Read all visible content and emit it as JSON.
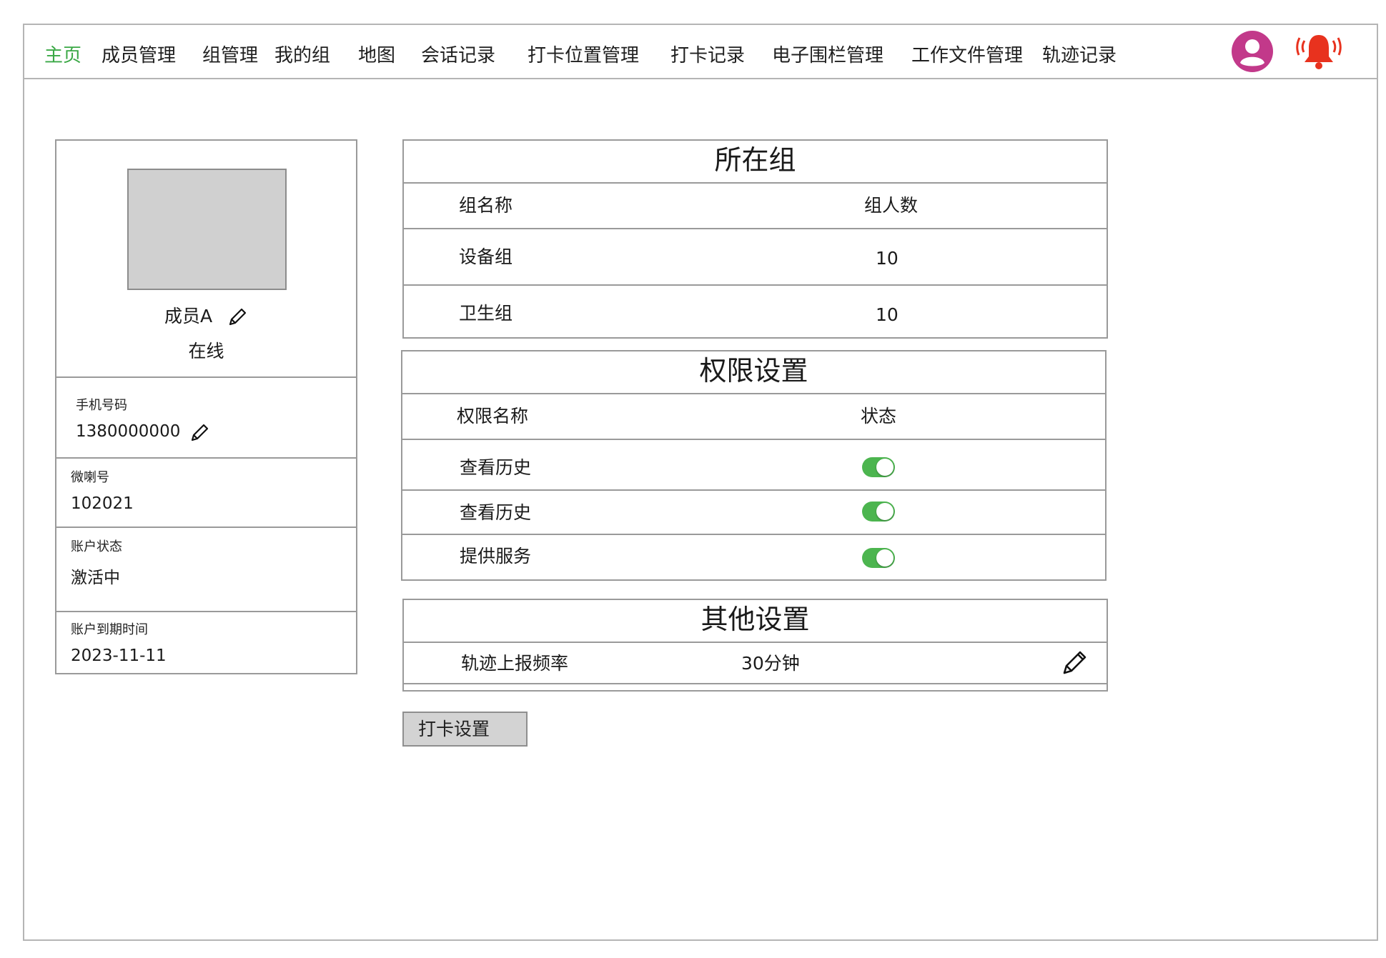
{
  "nav": {
    "items": [
      {
        "label": "主页",
        "active": true
      },
      {
        "label": "成员管理"
      },
      {
        "label": "组管理"
      },
      {
        "label": "我的组"
      },
      {
        "label": "地图"
      },
      {
        "label": "会话记录"
      },
      {
        "label": "打卡位置管理"
      },
      {
        "label": "打卡记录"
      },
      {
        "label": "电子围栏管理"
      },
      {
        "label": "工作文件管理"
      },
      {
        "label": "轨迹记录"
      }
    ],
    "active_color": "#3aa845",
    "avatar_icon": "user-avatar-icon",
    "alarm_icon": "alarm-bell-icon",
    "avatar_color": "#c2398a",
    "alarm_color": "#e8321e"
  },
  "profile": {
    "name": "成员A",
    "status": "在线",
    "phone_label": "手机号码",
    "phone": "1380000000",
    "wechat_label": "微喇号",
    "wechat": "102021",
    "account_status_label": "账户状态",
    "account_status": "激活中",
    "expiry_label": "账户到期时间",
    "expiry": "2023-11-11"
  },
  "groups": {
    "title": "所在组",
    "headers": [
      "组名称",
      "组人数"
    ],
    "rows": [
      {
        "name": "设备组",
        "count": "10"
      },
      {
        "name": "卫生组",
        "count": "10"
      }
    ]
  },
  "permissions": {
    "title": "权限设置",
    "headers": [
      "权限名称",
      "状态"
    ],
    "rows": [
      {
        "name": "查看历史",
        "enabled": true
      },
      {
        "name": "查看历史",
        "enabled": true
      },
      {
        "name": "提供服务",
        "enabled": true
      }
    ],
    "toggle_on_color": "#4cb54f"
  },
  "other": {
    "title": "其他设置",
    "rows": [
      {
        "name": "轨迹上报频率",
        "value": "30分钟"
      }
    ]
  },
  "punch_button": "打卡设置"
}
